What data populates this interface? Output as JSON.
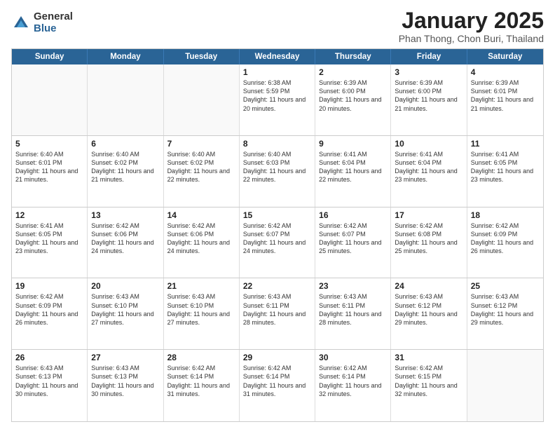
{
  "logo": {
    "general": "General",
    "blue": "Blue"
  },
  "title": {
    "month": "January 2025",
    "location": "Phan Thong, Chon Buri, Thailand"
  },
  "header_days": [
    "Sunday",
    "Monday",
    "Tuesday",
    "Wednesday",
    "Thursday",
    "Friday",
    "Saturday"
  ],
  "weeks": [
    [
      {
        "day": "",
        "sunrise": "",
        "sunset": "",
        "daylight": "",
        "empty": true
      },
      {
        "day": "",
        "sunrise": "",
        "sunset": "",
        "daylight": "",
        "empty": true
      },
      {
        "day": "",
        "sunrise": "",
        "sunset": "",
        "daylight": "",
        "empty": true
      },
      {
        "day": "1",
        "sunrise": "Sunrise: 6:38 AM",
        "sunset": "Sunset: 5:59 PM",
        "daylight": "Daylight: 11 hours and 20 minutes.",
        "empty": false
      },
      {
        "day": "2",
        "sunrise": "Sunrise: 6:39 AM",
        "sunset": "Sunset: 6:00 PM",
        "daylight": "Daylight: 11 hours and 20 minutes.",
        "empty": false
      },
      {
        "day": "3",
        "sunrise": "Sunrise: 6:39 AM",
        "sunset": "Sunset: 6:00 PM",
        "daylight": "Daylight: 11 hours and 21 minutes.",
        "empty": false
      },
      {
        "day": "4",
        "sunrise": "Sunrise: 6:39 AM",
        "sunset": "Sunset: 6:01 PM",
        "daylight": "Daylight: 11 hours and 21 minutes.",
        "empty": false
      }
    ],
    [
      {
        "day": "5",
        "sunrise": "Sunrise: 6:40 AM",
        "sunset": "Sunset: 6:01 PM",
        "daylight": "Daylight: 11 hours and 21 minutes.",
        "empty": false
      },
      {
        "day": "6",
        "sunrise": "Sunrise: 6:40 AM",
        "sunset": "Sunset: 6:02 PM",
        "daylight": "Daylight: 11 hours and 21 minutes.",
        "empty": false
      },
      {
        "day": "7",
        "sunrise": "Sunrise: 6:40 AM",
        "sunset": "Sunset: 6:02 PM",
        "daylight": "Daylight: 11 hours and 22 minutes.",
        "empty": false
      },
      {
        "day": "8",
        "sunrise": "Sunrise: 6:40 AM",
        "sunset": "Sunset: 6:03 PM",
        "daylight": "Daylight: 11 hours and 22 minutes.",
        "empty": false
      },
      {
        "day": "9",
        "sunrise": "Sunrise: 6:41 AM",
        "sunset": "Sunset: 6:04 PM",
        "daylight": "Daylight: 11 hours and 22 minutes.",
        "empty": false
      },
      {
        "day": "10",
        "sunrise": "Sunrise: 6:41 AM",
        "sunset": "Sunset: 6:04 PM",
        "daylight": "Daylight: 11 hours and 23 minutes.",
        "empty": false
      },
      {
        "day": "11",
        "sunrise": "Sunrise: 6:41 AM",
        "sunset": "Sunset: 6:05 PM",
        "daylight": "Daylight: 11 hours and 23 minutes.",
        "empty": false
      }
    ],
    [
      {
        "day": "12",
        "sunrise": "Sunrise: 6:41 AM",
        "sunset": "Sunset: 6:05 PM",
        "daylight": "Daylight: 11 hours and 23 minutes.",
        "empty": false
      },
      {
        "day": "13",
        "sunrise": "Sunrise: 6:42 AM",
        "sunset": "Sunset: 6:06 PM",
        "daylight": "Daylight: 11 hours and 24 minutes.",
        "empty": false
      },
      {
        "day": "14",
        "sunrise": "Sunrise: 6:42 AM",
        "sunset": "Sunset: 6:06 PM",
        "daylight": "Daylight: 11 hours and 24 minutes.",
        "empty": false
      },
      {
        "day": "15",
        "sunrise": "Sunrise: 6:42 AM",
        "sunset": "Sunset: 6:07 PM",
        "daylight": "Daylight: 11 hours and 24 minutes.",
        "empty": false
      },
      {
        "day": "16",
        "sunrise": "Sunrise: 6:42 AM",
        "sunset": "Sunset: 6:07 PM",
        "daylight": "Daylight: 11 hours and 25 minutes.",
        "empty": false
      },
      {
        "day": "17",
        "sunrise": "Sunrise: 6:42 AM",
        "sunset": "Sunset: 6:08 PM",
        "daylight": "Daylight: 11 hours and 25 minutes.",
        "empty": false
      },
      {
        "day": "18",
        "sunrise": "Sunrise: 6:42 AM",
        "sunset": "Sunset: 6:09 PM",
        "daylight": "Daylight: 11 hours and 26 minutes.",
        "empty": false
      }
    ],
    [
      {
        "day": "19",
        "sunrise": "Sunrise: 6:42 AM",
        "sunset": "Sunset: 6:09 PM",
        "daylight": "Daylight: 11 hours and 26 minutes.",
        "empty": false
      },
      {
        "day": "20",
        "sunrise": "Sunrise: 6:43 AM",
        "sunset": "Sunset: 6:10 PM",
        "daylight": "Daylight: 11 hours and 27 minutes.",
        "empty": false
      },
      {
        "day": "21",
        "sunrise": "Sunrise: 6:43 AM",
        "sunset": "Sunset: 6:10 PM",
        "daylight": "Daylight: 11 hours and 27 minutes.",
        "empty": false
      },
      {
        "day": "22",
        "sunrise": "Sunrise: 6:43 AM",
        "sunset": "Sunset: 6:11 PM",
        "daylight": "Daylight: 11 hours and 28 minutes.",
        "empty": false
      },
      {
        "day": "23",
        "sunrise": "Sunrise: 6:43 AM",
        "sunset": "Sunset: 6:11 PM",
        "daylight": "Daylight: 11 hours and 28 minutes.",
        "empty": false
      },
      {
        "day": "24",
        "sunrise": "Sunrise: 6:43 AM",
        "sunset": "Sunset: 6:12 PM",
        "daylight": "Daylight: 11 hours and 29 minutes.",
        "empty": false
      },
      {
        "day": "25",
        "sunrise": "Sunrise: 6:43 AM",
        "sunset": "Sunset: 6:12 PM",
        "daylight": "Daylight: 11 hours and 29 minutes.",
        "empty": false
      }
    ],
    [
      {
        "day": "26",
        "sunrise": "Sunrise: 6:43 AM",
        "sunset": "Sunset: 6:13 PM",
        "daylight": "Daylight: 11 hours and 30 minutes.",
        "empty": false
      },
      {
        "day": "27",
        "sunrise": "Sunrise: 6:43 AM",
        "sunset": "Sunset: 6:13 PM",
        "daylight": "Daylight: 11 hours and 30 minutes.",
        "empty": false
      },
      {
        "day": "28",
        "sunrise": "Sunrise: 6:42 AM",
        "sunset": "Sunset: 6:14 PM",
        "daylight": "Daylight: 11 hours and 31 minutes.",
        "empty": false
      },
      {
        "day": "29",
        "sunrise": "Sunrise: 6:42 AM",
        "sunset": "Sunset: 6:14 PM",
        "daylight": "Daylight: 11 hours and 31 minutes.",
        "empty": false
      },
      {
        "day": "30",
        "sunrise": "Sunrise: 6:42 AM",
        "sunset": "Sunset: 6:14 PM",
        "daylight": "Daylight: 11 hours and 32 minutes.",
        "empty": false
      },
      {
        "day": "31",
        "sunrise": "Sunrise: 6:42 AM",
        "sunset": "Sunset: 6:15 PM",
        "daylight": "Daylight: 11 hours and 32 minutes.",
        "empty": false
      },
      {
        "day": "",
        "sunrise": "",
        "sunset": "",
        "daylight": "",
        "empty": true
      }
    ]
  ]
}
